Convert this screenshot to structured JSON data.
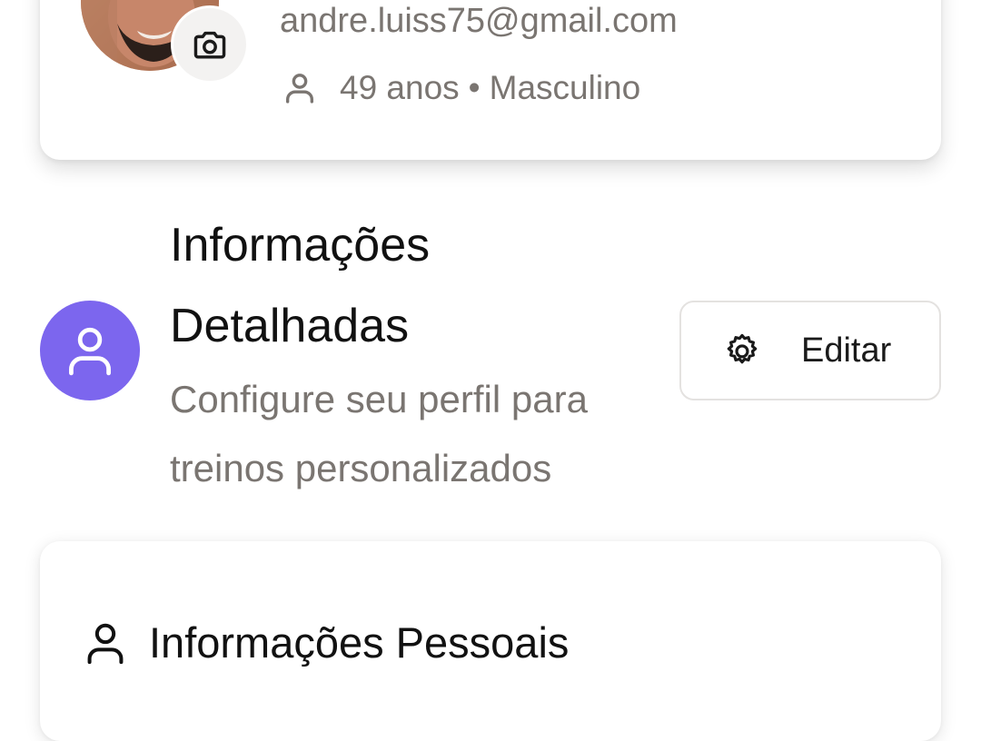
{
  "profile": {
    "email": "andre.luiss75@gmail.com",
    "age": "49 anos",
    "separator": "•",
    "gender": "Masculino",
    "icons": {
      "avatar": "user-photo",
      "camera": "camera-icon",
      "meta": "user-icon"
    }
  },
  "section": {
    "title": "Informações Detalhadas",
    "subtitle": "Configure seu perfil para treinos personalizados",
    "accent_color": "#7c66ee",
    "edit_button": {
      "label": "Editar",
      "icon": "gear-icon"
    }
  },
  "personal_info_card": {
    "title": "Informações Pessoais",
    "icon": "user-icon"
  }
}
